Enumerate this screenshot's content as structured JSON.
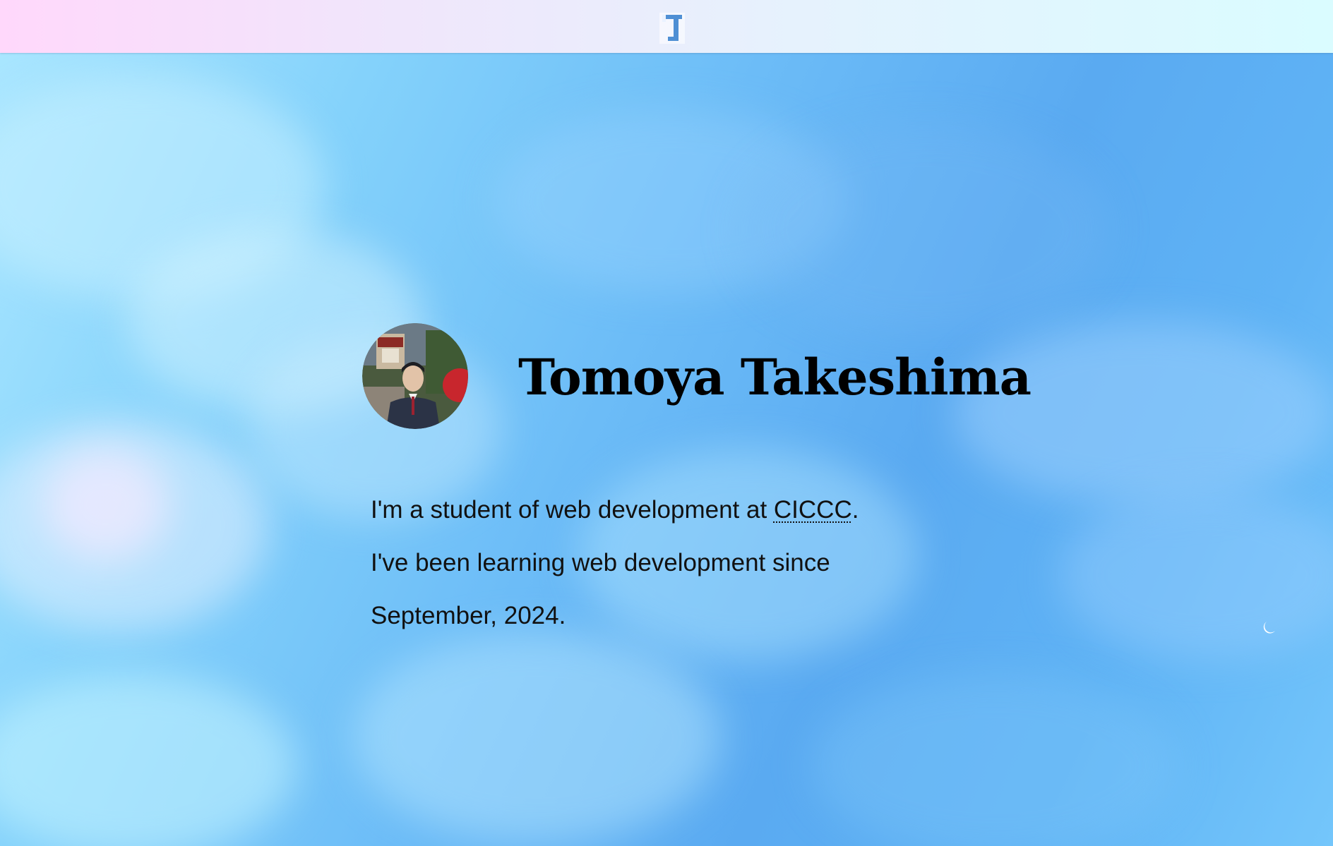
{
  "header": {
    "logo_icon": "T-logo-icon",
    "gradient_colors": [
      "#ffd8fb",
      "#dafcff"
    ]
  },
  "profile": {
    "name": "Tomoya Takeshima",
    "avatar": "profile-photo"
  },
  "bio": {
    "line1_prefix": "I'm a student of web development at ",
    "line1_abbr": "CICCC",
    "line1_suffix": ".",
    "line2": "I've been learning web development since September, 2024."
  },
  "theme_toggle": {
    "icon": "moon-icon"
  },
  "colors": {
    "sky_light": "#a9e6ff",
    "sky_deep": "#5aaaf1",
    "text": "#000000"
  }
}
